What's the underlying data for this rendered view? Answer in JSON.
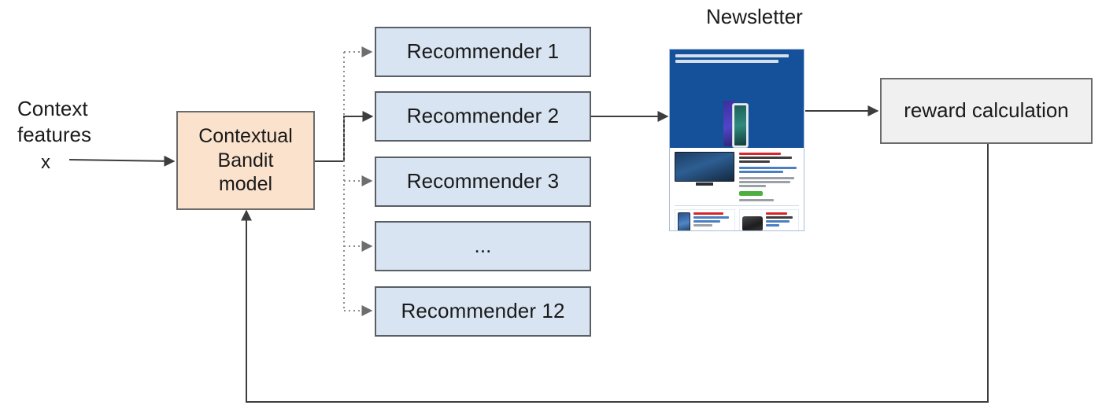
{
  "diagram": {
    "title_visible": false,
    "context_label": "Context\nfeatures",
    "context_variable": "x",
    "bandit_model_label": "Contextual\nBandit\nmodel",
    "newsletter_title": "Newsletter",
    "reward_label": "reward calculation",
    "recommenders": [
      {
        "label": "Recommender 1"
      },
      {
        "label": "Recommender 2"
      },
      {
        "label": "Recommender 3"
      },
      {
        "label": "..."
      },
      {
        "label": "Recommender 12"
      }
    ],
    "colors": {
      "recommender_fill": "#d8e4f2",
      "recommender_border": "#5a5f66",
      "bandit_fill": "#fbe2cc",
      "bandit_border": "#6b6b6b",
      "reward_fill": "#f0f0f0",
      "reward_border": "#6b6b6b",
      "arrow_solid": "#3d3d3d",
      "arrow_dotted": "#8c8c8c",
      "newsletter_banner": "#15519b",
      "text": "#1a1a1a",
      "background": "#ffffff"
    }
  }
}
